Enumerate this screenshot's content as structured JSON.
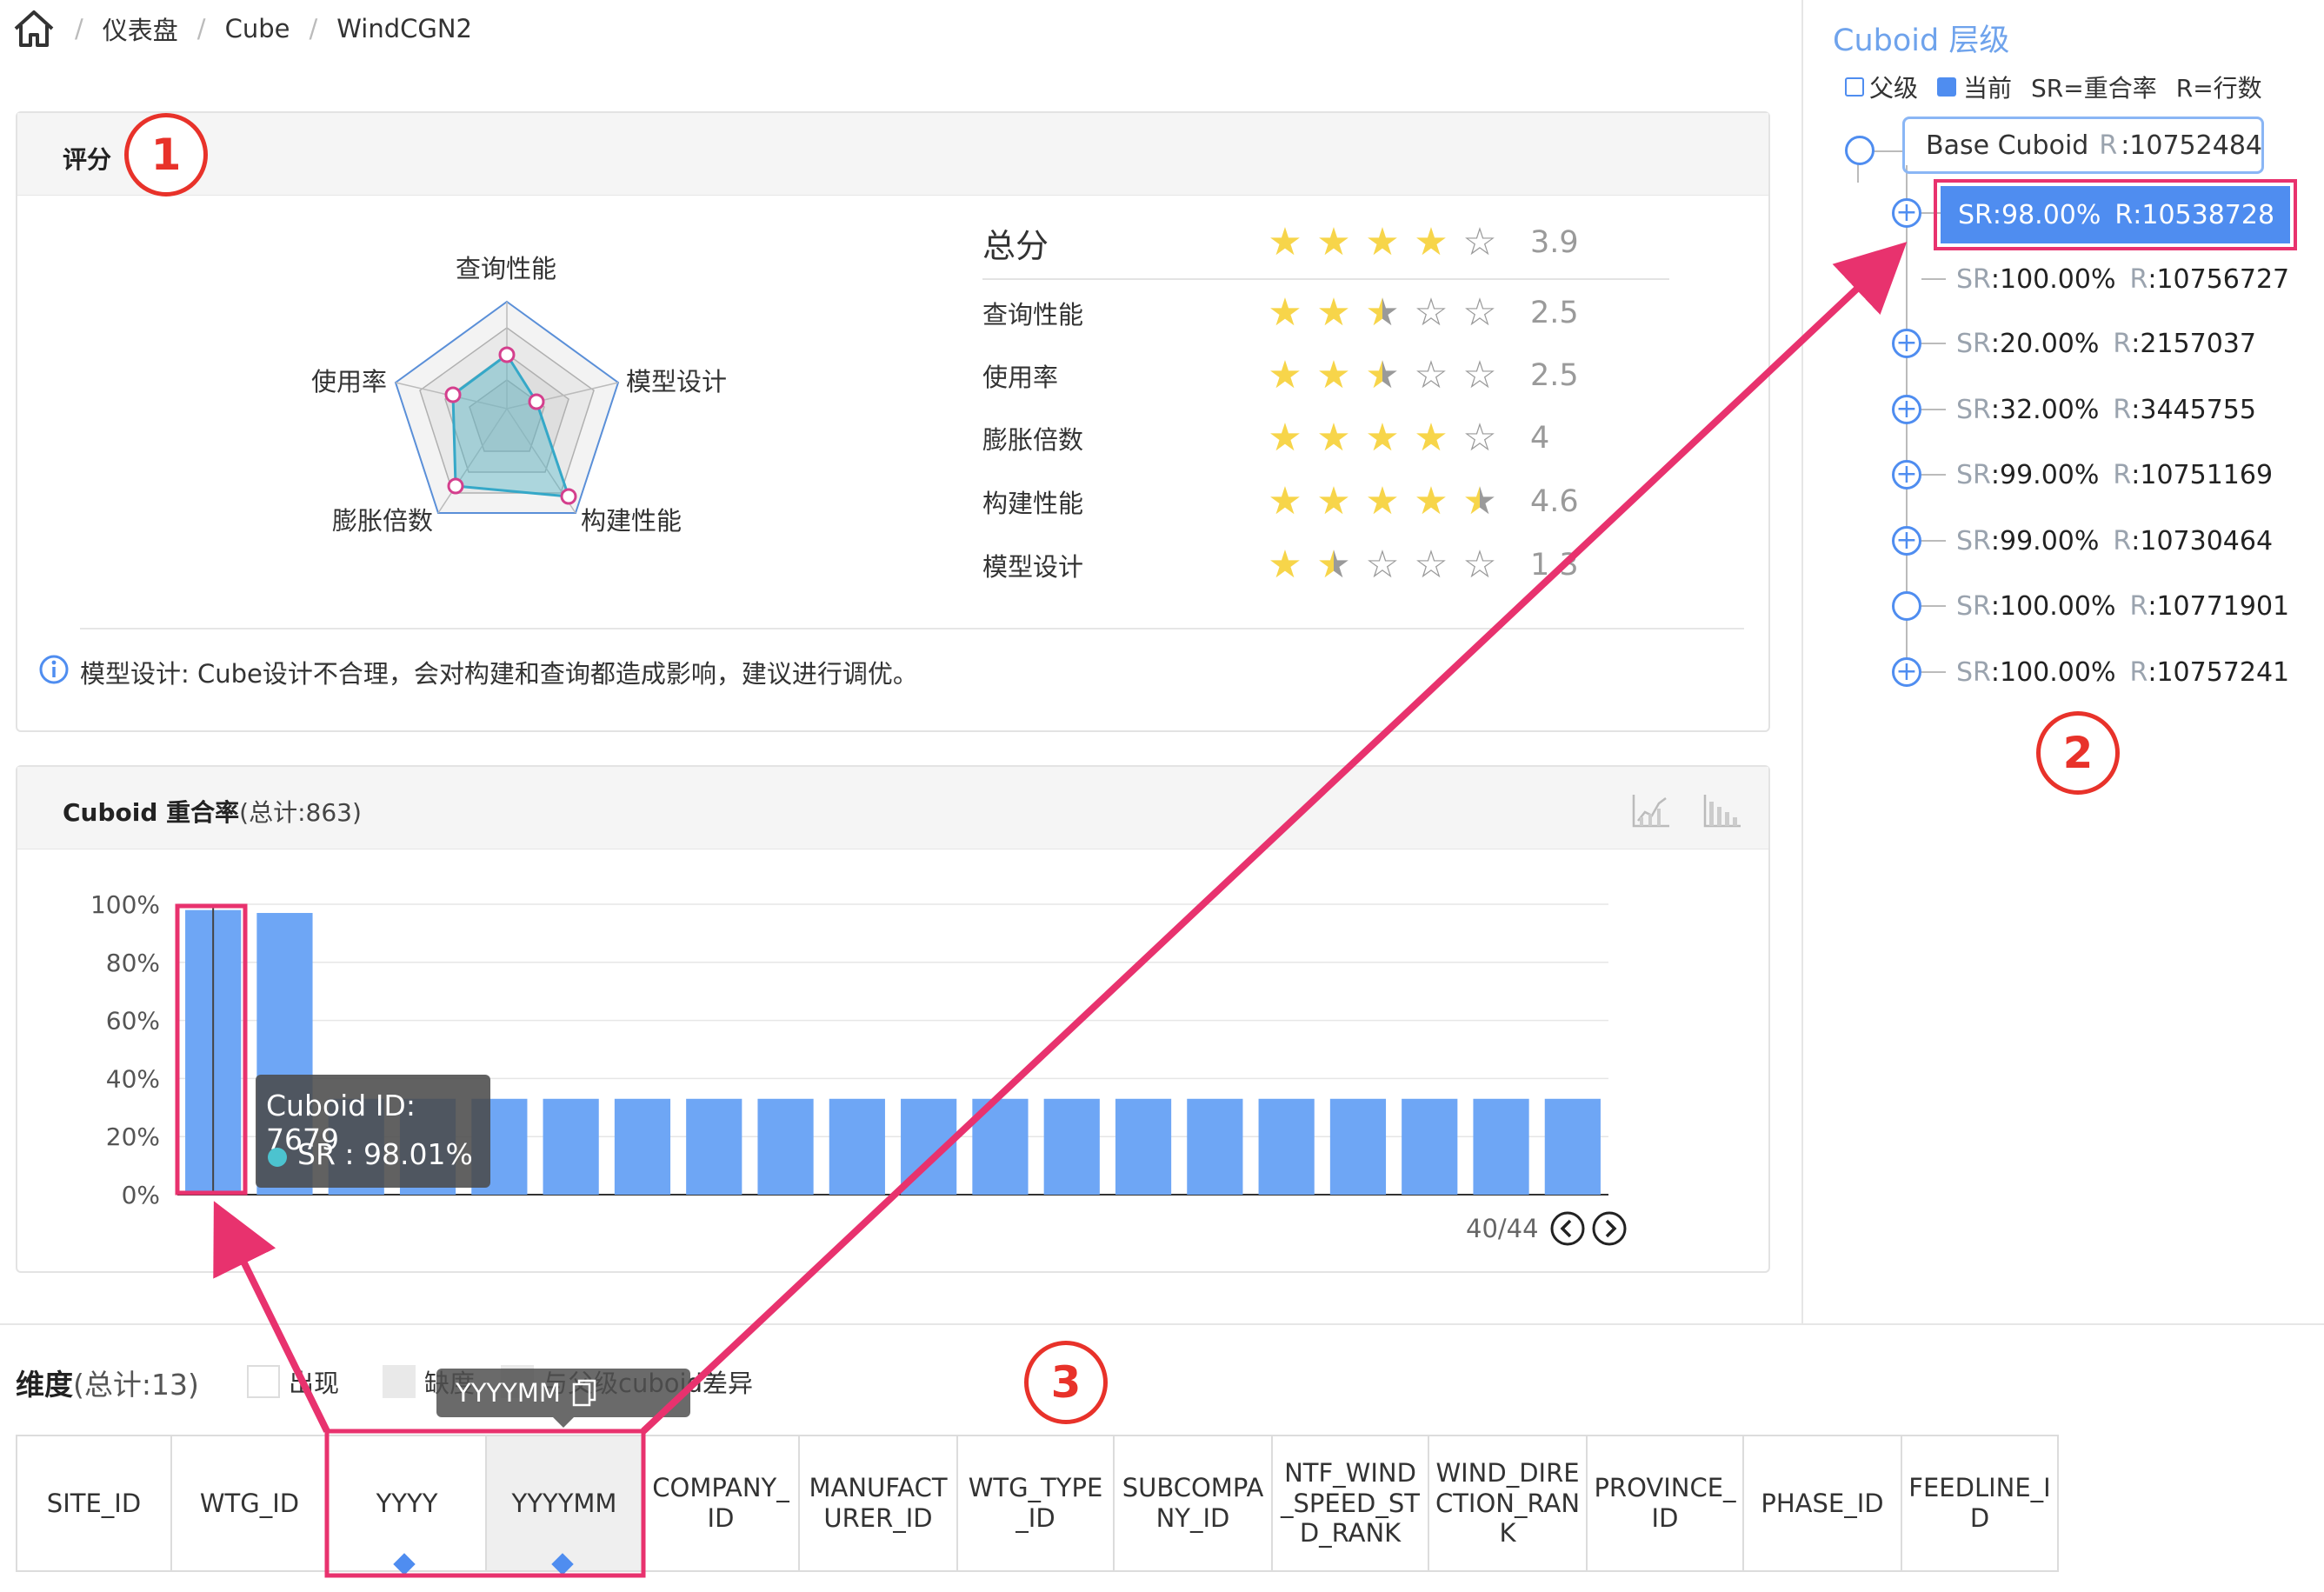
{
  "breadcrumb": {
    "items": [
      "仪表盘",
      "Cube",
      "WindCGN2"
    ]
  },
  "score_panel": {
    "title": "评分",
    "radar_labels": [
      "查询性能",
      "模型设计",
      "构建性能",
      "膨胀倍数",
      "使用率"
    ],
    "total_label": "总分",
    "total_score": "3.9",
    "total_stars": 3.9,
    "metrics": [
      {
        "label": "查询性能",
        "score": "2.5",
        "stars": 2.5
      },
      {
        "label": "使用率",
        "score": "2.5",
        "stars": 2.5
      },
      {
        "label": "膨胀倍数",
        "score": "4",
        "stars": 4
      },
      {
        "label": "构建性能",
        "score": "4.6",
        "stars": 4.6
      },
      {
        "label": "模型设计",
        "score": "1.3",
        "stars": 1.3
      }
    ],
    "info_text": "模型设计: Cube设计不合理，会对构建和查询都造成影响，建议进行调优。"
  },
  "overlap_panel": {
    "title": "Cuboid 重合率",
    "total": "(总计:863)",
    "pagination": "40/44",
    "tooltip_title": "Cuboid ID: 7679",
    "tooltip_value": "SR : 98.01%"
  },
  "chart_data": {
    "type": "bar",
    "yticks": [
      "100%",
      "80%",
      "60%",
      "40%",
      "20%",
      "0%"
    ],
    "ylim": [
      0,
      100
    ],
    "values": [
      98.01,
      97,
      33,
      33,
      33,
      33,
      33,
      33,
      33,
      33,
      33,
      33,
      33,
      33,
      33,
      33,
      33,
      33,
      33,
      33
    ],
    "color": "#6ea6f5"
  },
  "dimensions": {
    "title": "维度",
    "total": "(总计:13)",
    "legend": [
      "出现",
      "缺度",
      "与父级cuboid差异"
    ],
    "hover_tooltip": "YYYYMM",
    "columns": [
      "SITE_ID",
      "WTG_ID",
      "YYYY",
      "YYYYMM",
      "COMPANY_ID",
      "MANUFACTURER_ID",
      "WTG_TYPE_ID",
      "SUBCOMPANY_ID",
      "NTF_WIND_SPEED_STD_RANK",
      "WIND_DIRECTION_RANK",
      "PROVINCE_ID",
      "PHASE_ID",
      "FEEDLINE_ID"
    ]
  },
  "hierarchy": {
    "title": "Cuboid 层级",
    "legend_parent": "父级",
    "legend_current": "当前",
    "legend_sr": "SR=重合率",
    "legend_r": "R=行数",
    "base_label": "Base Cuboid",
    "base_r_key": "R",
    "base_r_value": ":10752484",
    "children": [
      {
        "sr": ":98.00%",
        "r": ":10538728"
      },
      {
        "sr": ":100.00%",
        "r": ":10756727"
      },
      {
        "sr": ":20.00%",
        "r": ":2157037"
      },
      {
        "sr": ":32.00%",
        "r": ":3445755"
      },
      {
        "sr": ":99.00%",
        "r": ":10751169"
      },
      {
        "sr": ":99.00%",
        "r": ":10730464"
      },
      {
        "sr": ":100.00%",
        "r": ":10771901"
      },
      {
        "sr": ":100.00%",
        "r": ":10757241"
      }
    ]
  },
  "markers": [
    "1",
    "2",
    "3"
  ],
  "colors": {
    "accent": "#4f8df0",
    "highlight": "#e8326e",
    "marker": "#e8322a"
  }
}
